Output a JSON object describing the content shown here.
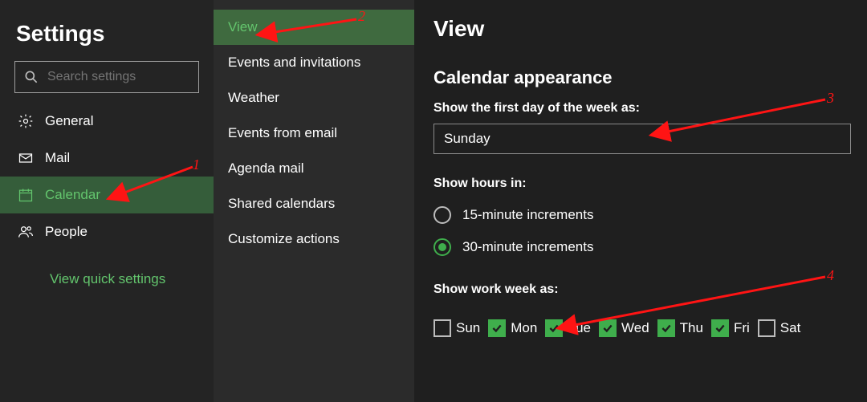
{
  "left": {
    "title": "Settings",
    "search_placeholder": "Search settings",
    "items": [
      {
        "icon": "gear-icon",
        "label": "General",
        "selected": false
      },
      {
        "icon": "mail-icon",
        "label": "Mail",
        "selected": false
      },
      {
        "icon": "calendar-icon",
        "label": "Calendar",
        "selected": true
      },
      {
        "icon": "people-icon",
        "label": "People",
        "selected": false
      }
    ],
    "quick_link": "View quick settings"
  },
  "mid": {
    "items": [
      {
        "label": "View",
        "selected": true
      },
      {
        "label": "Events and invitations",
        "selected": false
      },
      {
        "label": "Weather",
        "selected": false
      },
      {
        "label": "Events from email",
        "selected": false
      },
      {
        "label": "Agenda mail",
        "selected": false
      },
      {
        "label": "Shared calendars",
        "selected": false
      },
      {
        "label": "Customize actions",
        "selected": false
      }
    ]
  },
  "right": {
    "title": "View",
    "section_appearance": "Calendar appearance",
    "first_day_label": "Show the first day of the week as:",
    "first_day_value": "Sunday",
    "show_hours_label": "Show hours in:",
    "radios": [
      {
        "label": "15-minute increments",
        "checked": false
      },
      {
        "label": "30-minute increments",
        "checked": true
      }
    ],
    "work_week_label": "Show work week as:",
    "days": [
      {
        "label": "Sun",
        "checked": false
      },
      {
        "label": "Mon",
        "checked": true
      },
      {
        "label": "Tue",
        "checked": true
      },
      {
        "label": "Wed",
        "checked": true
      },
      {
        "label": "Thu",
        "checked": true
      },
      {
        "label": "Fri",
        "checked": true
      },
      {
        "label": "Sat",
        "checked": false
      }
    ]
  },
  "annotations": [
    {
      "num": "1"
    },
    {
      "num": "2"
    },
    {
      "num": "3"
    },
    {
      "num": "4"
    }
  ],
  "icons": {
    "search": "search-icon",
    "gear": "gear-icon",
    "mail": "mail-icon",
    "calendar": "calendar-icon",
    "people": "people-icon"
  }
}
